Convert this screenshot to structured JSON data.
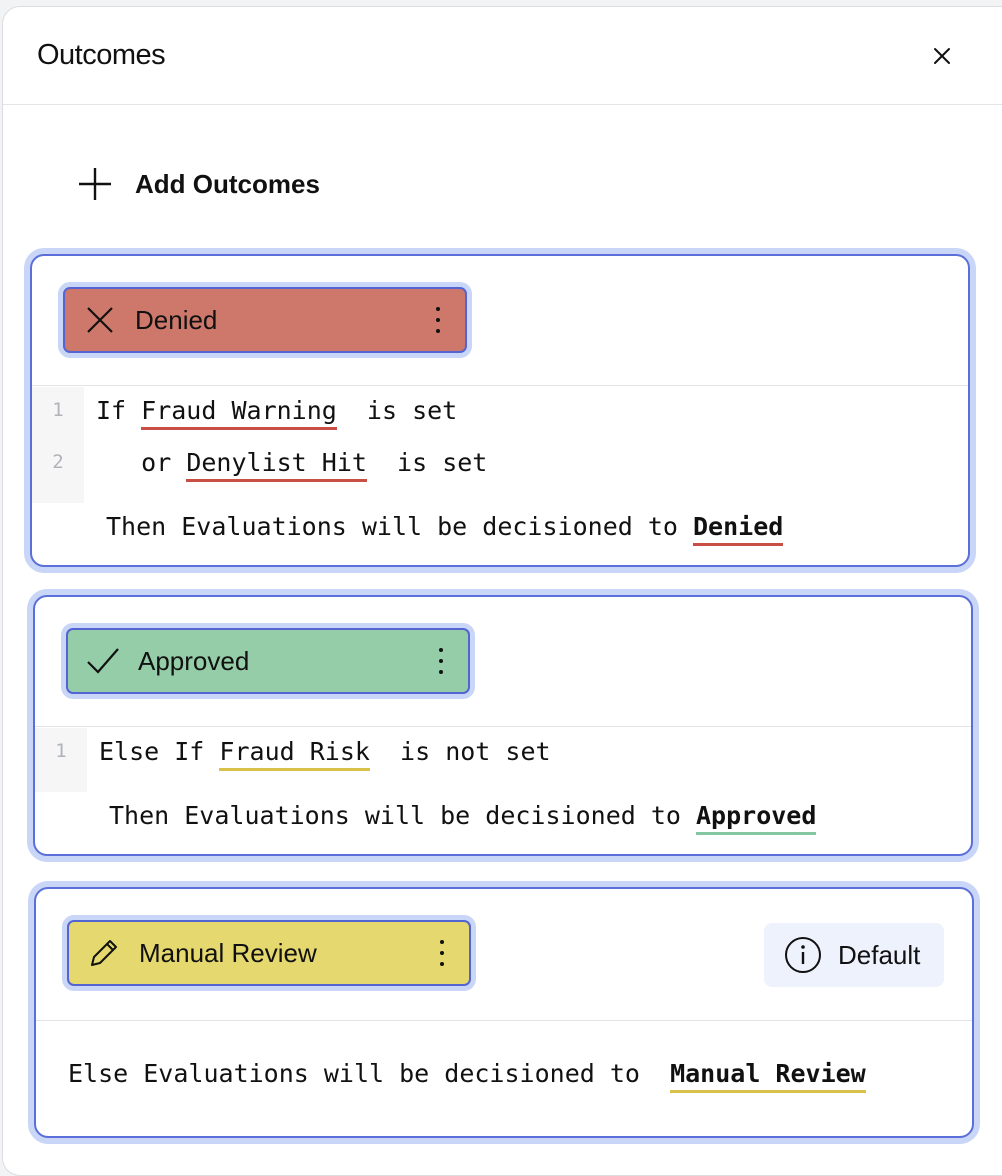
{
  "header": {
    "title": "Outcomes",
    "close_icon": "close-icon"
  },
  "toolbar": {
    "add_label": "Add Outcomes"
  },
  "outcomes": [
    {
      "name": "Denied",
      "color": "#cd786b",
      "underline_color": "#c94f44",
      "icon": "x-icon",
      "lines": [
        {
          "num": "1",
          "prefix": "If ",
          "variable": "Fraud Warning",
          "suffix": "  is set"
        },
        {
          "num": "2",
          "prefix": "   or ",
          "variable": "Denylist Hit",
          "suffix": "  is set"
        }
      ],
      "then_text": "Then Evaluations will be decisioned to ",
      "then_value": "Denied"
    },
    {
      "name": "Approved",
      "color": "#95cda8",
      "underline_color": "#86c7a3",
      "icon": "check-icon",
      "lines": [
        {
          "num": "1",
          "prefix": "Else If ",
          "variable": "Fraud Risk",
          "suffix": "  is not set"
        }
      ],
      "then_text": "Then Evaluations will be decisioned to ",
      "then_value": "Approved"
    },
    {
      "name": "Manual Review",
      "color": "#e5d86e",
      "underline_color": "#d8c24a",
      "icon": "pencil-icon",
      "badge": "Default",
      "badge_icon": "info-icon",
      "then_text": "Else Evaluations will be decisioned to  ",
      "then_value": "Manual Review"
    }
  ]
}
